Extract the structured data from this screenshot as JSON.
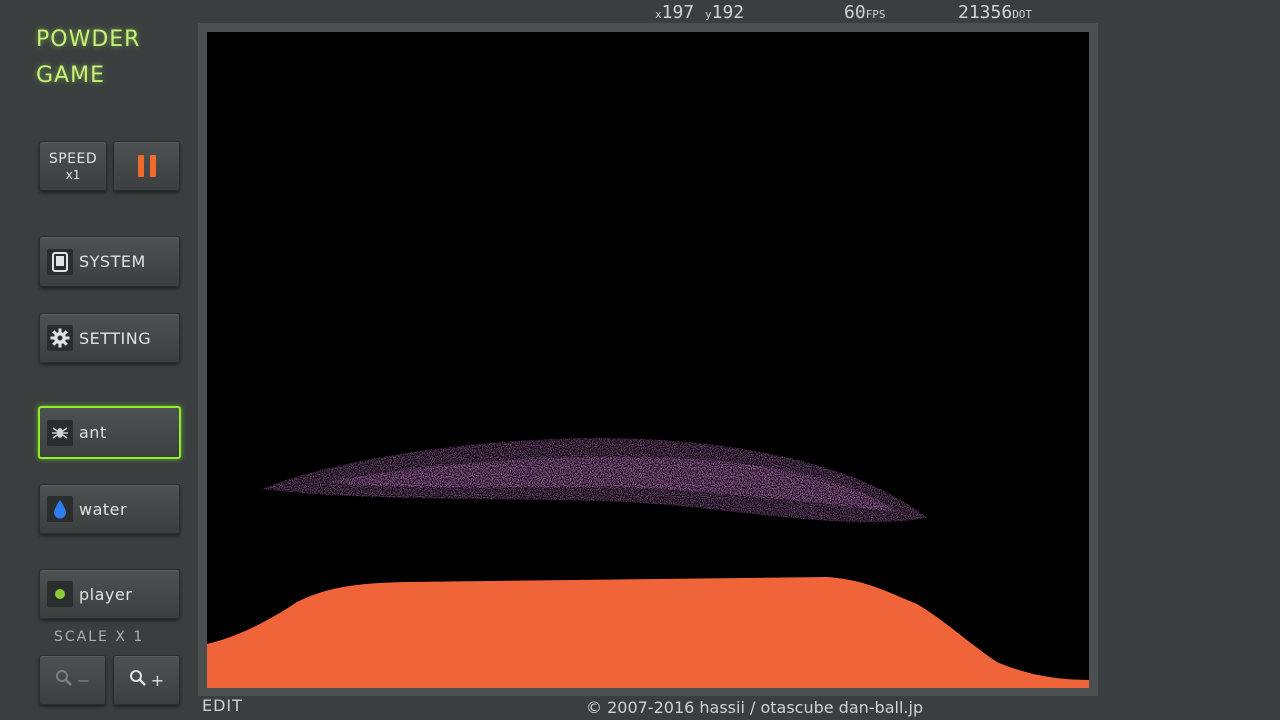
{
  "logo": {
    "line1": "POWDER",
    "line2": "GAME"
  },
  "hud": {
    "x_label": "x",
    "x_value": "197",
    "y_label": "y",
    "y_value": "192",
    "fps_value": "60",
    "fps_unit": "FPS",
    "dot_value": "21356",
    "dot_unit": "DOT"
  },
  "buttons": {
    "speed_label": "SPEED",
    "speed_mult": "x1",
    "system": "SYSTEM",
    "setting": "SETTING",
    "ant": "ant",
    "water": "water",
    "player": "player"
  },
  "scale": {
    "label": "SCALE x 1"
  },
  "zoom": {
    "out": "−",
    "in": "+"
  },
  "footer": {
    "edit": "EDIT",
    "copyright": "© 2007-2016 hassii / otascube dan-ball.jp"
  },
  "colors": {
    "accent": "#8ff02a",
    "logo": "#c8f07a",
    "pause": "#f06a2c",
    "sand": "#f0643a",
    "ant_cloud": "#c77ccf",
    "water_icon": "#2f7ef0"
  }
}
